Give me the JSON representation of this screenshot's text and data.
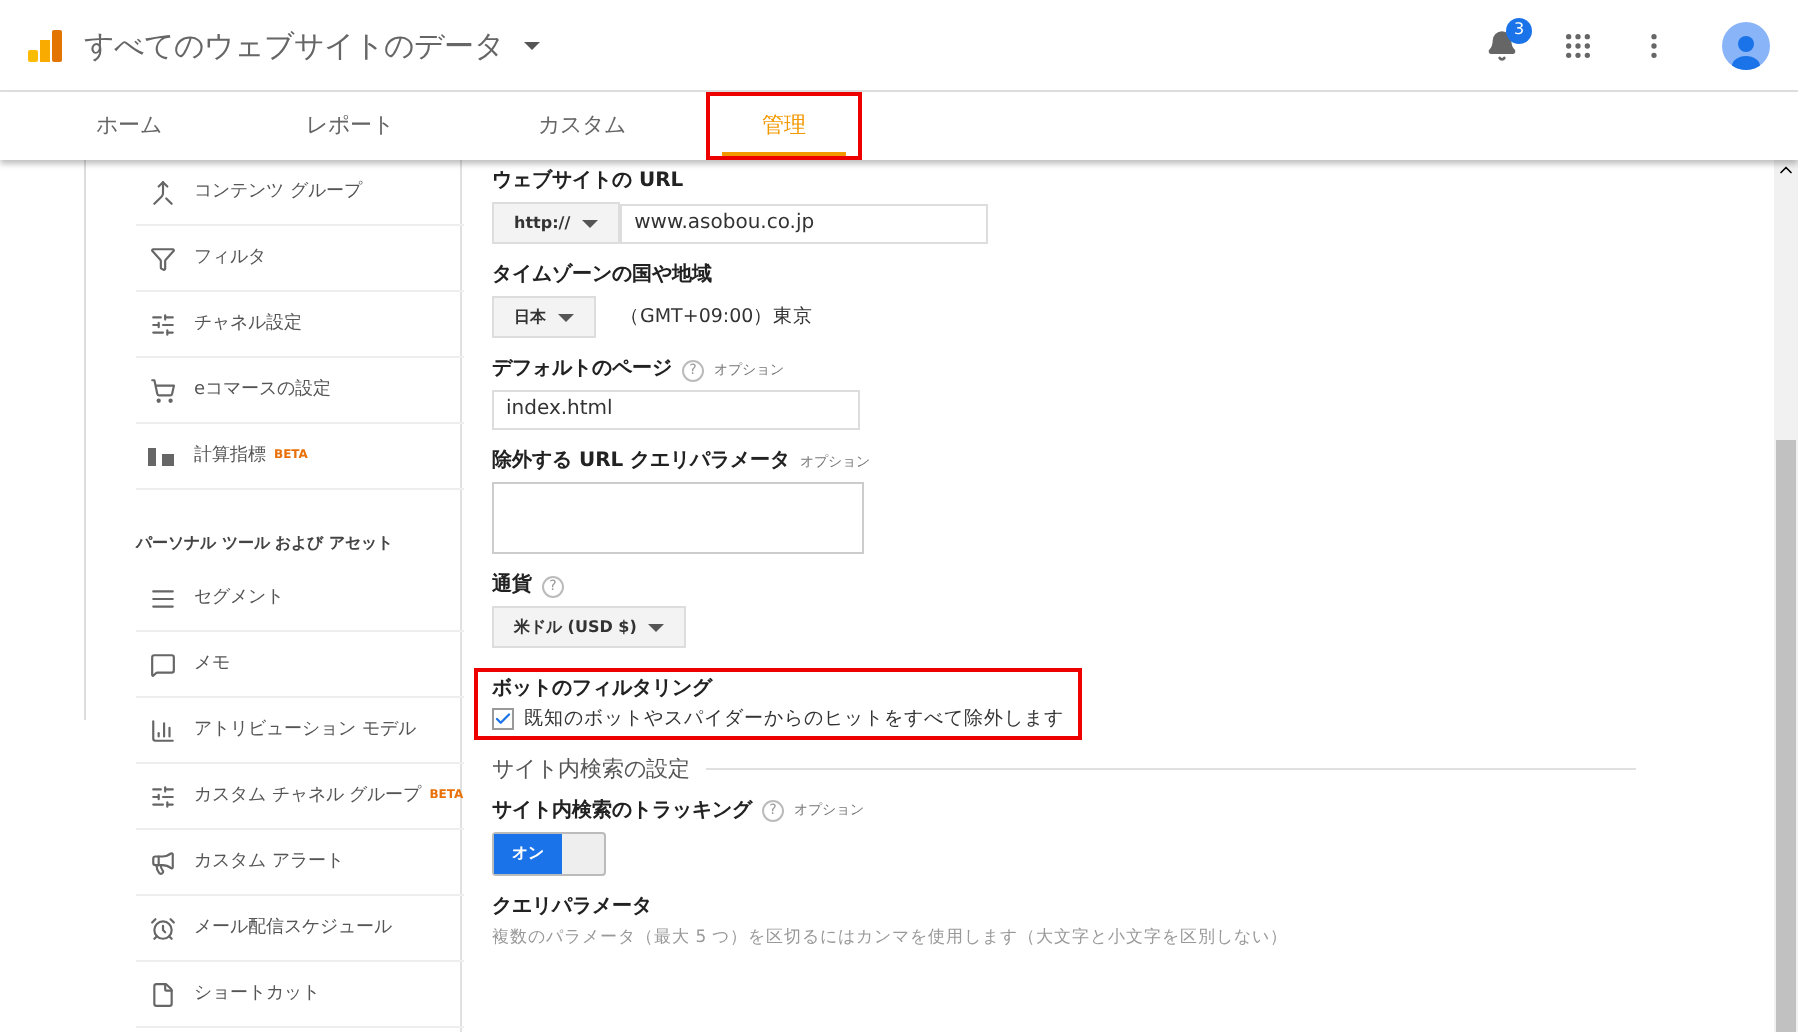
{
  "header": {
    "title": "すべてのウェブサイトのデータ",
    "notification_count": "3"
  },
  "tabs": [
    {
      "label": "ホーム",
      "selected": false,
      "highlighted": false
    },
    {
      "label": "レポート",
      "selected": false,
      "highlighted": false
    },
    {
      "label": "カスタム",
      "selected": false,
      "highlighted": false
    },
    {
      "label": "管理",
      "selected": true,
      "highlighted": true
    }
  ],
  "sidebar": {
    "items": [
      {
        "kind": "item",
        "label": "コンテンツ グループ"
      },
      {
        "kind": "item",
        "label": "フィルタ"
      },
      {
        "kind": "item",
        "label": "チャネル設定"
      },
      {
        "kind": "item",
        "label": "eコマースの設定"
      },
      {
        "kind": "item",
        "label": "計算指標",
        "badge": "BETA"
      },
      {
        "kind": "section",
        "label": "パーソナル ツール および アセット"
      },
      {
        "kind": "item",
        "label": "セグメント"
      },
      {
        "kind": "item",
        "label": "メモ"
      },
      {
        "kind": "item",
        "label": "アトリビューション モデル"
      },
      {
        "kind": "item",
        "label": "カスタム チャネル グループ",
        "badge": "BETA"
      },
      {
        "kind": "item",
        "label": "カスタム アラート"
      },
      {
        "kind": "item",
        "label": "メール配信スケジュール"
      },
      {
        "kind": "item",
        "label": "ショートカット"
      }
    ]
  },
  "form": {
    "website_url": {
      "label": "ウェブサイトの URL",
      "protocol": "http://",
      "value": "www.asobou.co.jp"
    },
    "timezone": {
      "label": "タイムゾーンの国や地域",
      "country": "日本",
      "zone": "（GMT+09:00）東京"
    },
    "default_page": {
      "label": "デフォルトのページ",
      "help": "?",
      "optional": "オプション",
      "value": "index.html"
    },
    "exclude_params": {
      "label": "除外する URL クエリパラメータ",
      "optional": "オプション"
    },
    "currency": {
      "label": "通貨",
      "help": "?",
      "value": "米ドル (USD $)"
    },
    "bot_filtering": {
      "label": "ボットのフィルタリング",
      "checkbox_label": "既知のボットやスパイダーからのヒットをすべて除外します",
      "checked": true,
      "highlighted": true
    },
    "site_search_title": "サイト内検索の設定",
    "tracking": {
      "label": "サイト内検索のトラッキング",
      "help": "?",
      "optional": "オプション",
      "toggle_label": "オン",
      "on": true
    },
    "query_param": {
      "label": "クエリパラメータ",
      "hint": "複数のパラメータ（最大 5 つ）を区切るにはカンマを使用します（大文字と小文字を区別しない）"
    }
  }
}
